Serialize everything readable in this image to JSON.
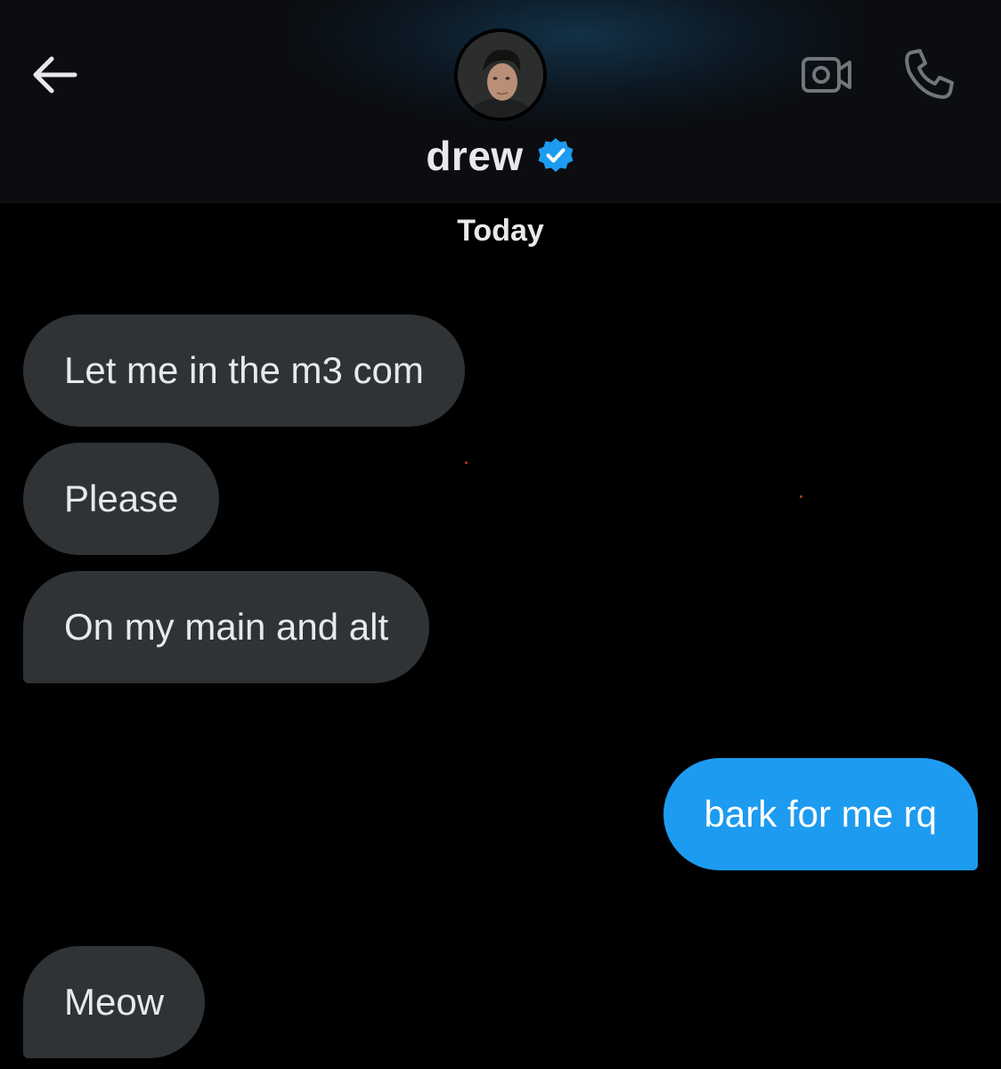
{
  "header": {
    "contact_name": "drew",
    "verified": true,
    "back_icon": "arrow-left-icon",
    "video_icon": "video-camera-icon",
    "call_icon": "phone-icon",
    "verified_icon": "verified-badge-icon",
    "colors": {
      "verified_badge": "#1d9bf0",
      "icon_gray": "#71767b"
    }
  },
  "conversation": {
    "date_separator": "Today",
    "messages": [
      {
        "direction": "incoming",
        "text": "Let me in the m3 com"
      },
      {
        "direction": "incoming",
        "text": "Please"
      },
      {
        "direction": "incoming",
        "text": "On my main and alt"
      },
      {
        "direction": "outgoing",
        "text": "bark for me rq"
      },
      {
        "direction": "incoming",
        "text": "Meow"
      }
    ],
    "colors": {
      "incoming_bubble": "#2f3336",
      "outgoing_bubble": "#1d9bf0",
      "background": "#000000"
    }
  }
}
